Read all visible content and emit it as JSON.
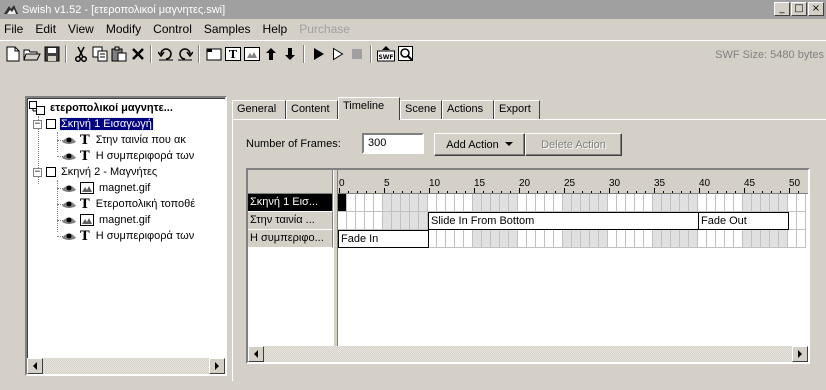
{
  "window": {
    "title": "Swish v1.52 - [ετεροπολικοί μαγνητες.swi]",
    "minimize_glyph": "_",
    "maximize_glyph": "□",
    "close_glyph": "×"
  },
  "menubar": {
    "items": [
      {
        "label": "File",
        "enabled": true
      },
      {
        "label": "Edit",
        "enabled": true
      },
      {
        "label": "View",
        "enabled": true
      },
      {
        "label": "Modify",
        "enabled": true
      },
      {
        "label": "Control",
        "enabled": true
      },
      {
        "label": "Samples",
        "enabled": true
      },
      {
        "label": "Help",
        "enabled": true
      },
      {
        "label": "Purchase",
        "enabled": false
      }
    ]
  },
  "toolbar": {
    "icons": [
      "new-icon",
      "open-icon",
      "save-icon",
      "cut-icon",
      "copy-icon",
      "paste-icon",
      "delete-icon",
      "undo-icon",
      "redo-icon",
      "insert-scene-icon",
      "insert-text-icon",
      "insert-image-icon",
      "move-up-icon",
      "move-down-icon",
      "play-icon",
      "play-scene-icon",
      "stop-icon",
      "export-swf-icon",
      "preview-icon"
    ],
    "swf_size": "SWF Size: 5480 bytes"
  },
  "tree": {
    "items": [
      {
        "label": "ετεροπολικοί μαγνητε...",
        "kind": "movie",
        "level": 0
      },
      {
        "label": "Σκηνή 1 Εισαγωγή",
        "kind": "scene",
        "level": 1,
        "selected": true,
        "expanded": true
      },
      {
        "label": "Στην ταινία που ακ",
        "kind": "text",
        "level": 2
      },
      {
        "label": "Η συμπεριφορά των",
        "kind": "text",
        "level": 2
      },
      {
        "label": "Σκηνή 2 - Μαγνήτες",
        "kind": "scene",
        "level": 1,
        "expanded": true
      },
      {
        "label": "magnet.gif",
        "kind": "image",
        "level": 2
      },
      {
        "label": "Ετεροπολική τοποθέ",
        "kind": "text",
        "level": 2
      },
      {
        "label": "magnet.gif",
        "kind": "image",
        "level": 2
      },
      {
        "label": "Η συμπεριφορά των",
        "kind": "text",
        "level": 2
      }
    ],
    "expander_glyph": "−",
    "text_glyph": "T"
  },
  "tabs": {
    "items": [
      "General",
      "Content",
      "Timeline",
      "Scene",
      "Actions",
      "Export"
    ],
    "active": "Timeline"
  },
  "timeline_panel": {
    "frames_label": "Number of Frames:",
    "frames_value": "300",
    "add_action_label": "Add Action",
    "delete_action_label": "Delete Action"
  },
  "timeline": {
    "tick_labels": [
      "0",
      "5",
      "10",
      "15",
      "20",
      "25",
      "30",
      "35",
      "40",
      "45",
      "50"
    ],
    "rows": [
      {
        "name": "Σκηνή 1 Εισ...",
        "selected": true,
        "effects": [],
        "keyframe": 0
      },
      {
        "name": "Στην ταινία ...",
        "selected": false,
        "effects": [
          {
            "label": "Slide In From Bottom",
            "start": 10,
            "end": 40
          },
          {
            "label": "Fade Out",
            "start": 40,
            "end": 50
          }
        ]
      },
      {
        "name": "Η συμπεριφο...",
        "selected": false,
        "effects": [
          {
            "label": "Fade In",
            "start": 0,
            "end": 10
          }
        ]
      }
    ],
    "visible_frames": 52
  }
}
